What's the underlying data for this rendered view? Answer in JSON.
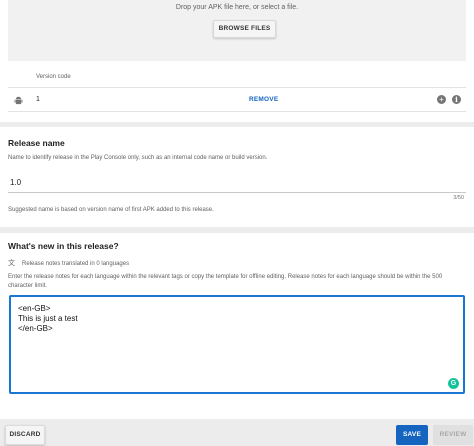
{
  "upload": {
    "drop_text": "Drop your APK file here, or select a file.",
    "browse_label": "BROWSE FILES"
  },
  "apk_table": {
    "column_header": "Version code",
    "rows": [
      {
        "icon": "android-icon",
        "version_code": "1",
        "remove_label": "REMOVE"
      }
    ]
  },
  "release_name": {
    "title": "Release name",
    "helper": "Name to identify release in the Play Console only, such as an internal code name or build version.",
    "value": "1.0",
    "counter": "3/50",
    "suggestion": "Suggested name is based on version name of first APK added to this release."
  },
  "whats_new": {
    "title": "What's new in this release?",
    "translated": "Release notes translated in 0 languages",
    "description": "Enter the release notes for each language within the relevant tags or copy the template for offline editing. Release notes for each language should be within the 500 character limit.",
    "notes_value": "<en-GB>\nThis is just a test\n</en-GB>"
  },
  "actions": {
    "discard_label": "DISCARD",
    "save_label": "SAVE",
    "review_label": "REVIEW"
  },
  "colors": {
    "accent": "#1565c0",
    "focus_border": "#1976d2",
    "grammarly": "#15c39a",
    "background": "#ececec"
  }
}
